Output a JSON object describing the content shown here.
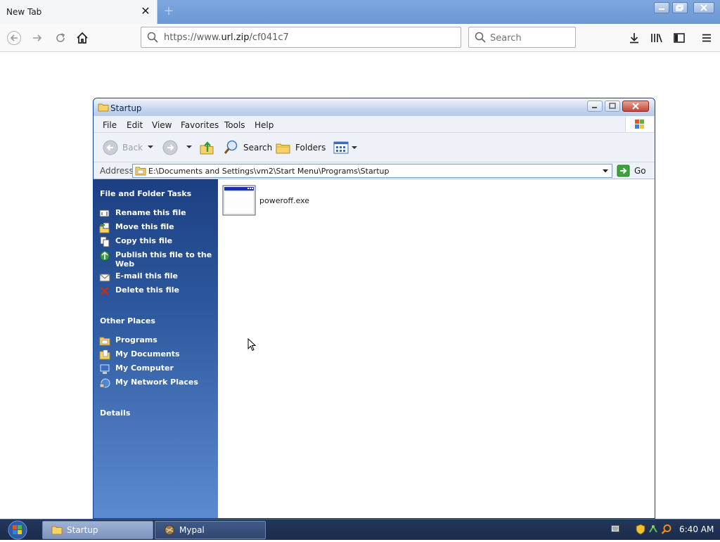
{
  "browser": {
    "tab_title": "New Tab",
    "url_prefix": "https://www.",
    "url_domain": "url.zip",
    "url_path": "/cf041c7",
    "search_placeholder": "Search"
  },
  "window": {
    "title": "Startup",
    "menu": [
      "File",
      "Edit",
      "View",
      "Favorites",
      "Tools",
      "Help"
    ],
    "toolbar": {
      "back": "Back",
      "search": "Search",
      "folders": "Folders"
    },
    "address": {
      "label": "Address",
      "path": "E:\\Documents and Settings\\vm2\\Start Menu\\Programs\\Startup",
      "go": "Go"
    }
  },
  "task_pane": {
    "file_tasks_heading": "File and Folder Tasks",
    "file_tasks": [
      {
        "label": "Rename this file",
        "icon": "rename-icon"
      },
      {
        "label": "Move this file",
        "icon": "move-icon"
      },
      {
        "label": "Copy this file",
        "icon": "copy-icon"
      },
      {
        "label": "Publish this file to the Web",
        "icon": "publish-icon"
      },
      {
        "label": "E-mail this file",
        "icon": "email-icon"
      },
      {
        "label": "Delete this file",
        "icon": "delete-icon"
      }
    ],
    "other_places_heading": "Other Places",
    "other_places": [
      {
        "label": "Programs",
        "icon": "folder-icon"
      },
      {
        "label": "My Documents",
        "icon": "my-documents-icon"
      },
      {
        "label": "My Computer",
        "icon": "my-computer-icon"
      },
      {
        "label": "My Network Places",
        "icon": "network-places-icon"
      }
    ],
    "details_heading": "Details"
  },
  "files": [
    {
      "name": "poweroff.exe",
      "icon": "executable-icon"
    }
  ],
  "taskbar": {
    "items": [
      {
        "label": "Startup",
        "active": true
      },
      {
        "label": "Mypal",
        "active": false
      }
    ],
    "clock": "6:40 AM"
  },
  "colors": {
    "task_pane_top": "#1c3f82",
    "task_pane_bottom": "#5d8bd0",
    "taskbar": "#1b2c4c",
    "browser_tabbar": "#6b97d4"
  }
}
